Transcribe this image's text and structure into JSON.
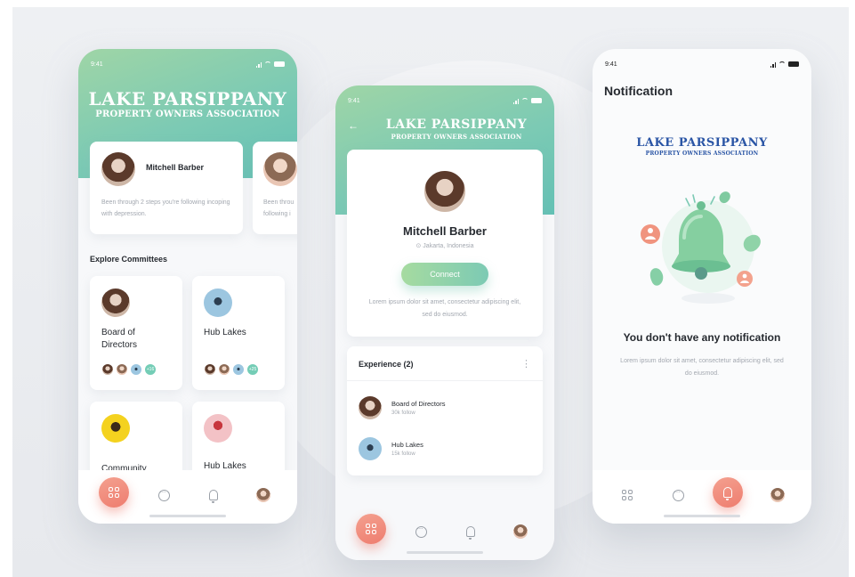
{
  "app": {
    "brand_title": "LAKE PARSIPPANY",
    "brand_subtitle": "PROPERTY OWNERS ASSOCIATION",
    "status_time": "9:41"
  },
  "screen_home": {
    "profile_card": {
      "name": "Mitchell Barber",
      "description": "Been through 2 steps you're following incoping with depression."
    },
    "peek_card": {
      "description": "Been throu following i"
    },
    "section_title": "Explore Committees",
    "committees": [
      {
        "title": "Board of Directors",
        "more": "+16"
      },
      {
        "title": "Hub Lakes",
        "more": "+25"
      },
      {
        "title": "Community"
      },
      {
        "title": "Hub Lakes"
      }
    ]
  },
  "screen_profile": {
    "back": "←",
    "name": "Mitchell Barber",
    "location": "Jakarta, Indonesia",
    "connect_label": "Connect",
    "bio": "Lorem ipsum dolor sit amet, consectetur adipiscing elit, sed do eiusmod.",
    "experience_title": "Experience (2)",
    "menu": "⋮",
    "experience": [
      {
        "title": "Board of Directors",
        "followers": "30k follow"
      },
      {
        "title": "Hub Lakes",
        "followers": "15k follow"
      }
    ]
  },
  "screen_notification": {
    "title": "Notification",
    "empty_title": "You don't have any notification",
    "empty_text": "Lorem ipsum dolor sit amet, consectetur adipiscing elit, sed do eiusmod."
  },
  "colors": {
    "accent_green": "#7ccab4",
    "accent_coral": "#ee7d6f",
    "brand_blue": "#2a55a5"
  },
  "icons": [
    "grid-icon",
    "chat-icon",
    "bell-icon",
    "location-pin-icon",
    "more-vertical-icon",
    "back-arrow-icon"
  ]
}
